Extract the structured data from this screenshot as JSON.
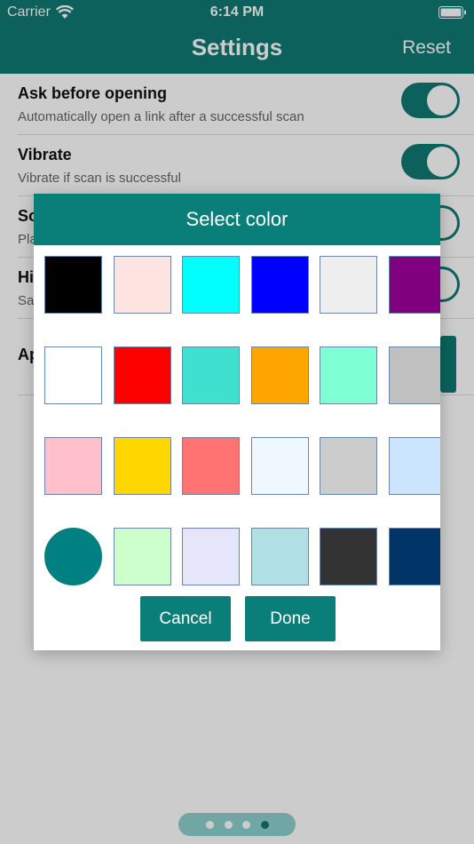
{
  "status_bar": {
    "carrier": "Carrier",
    "time": "6:14 PM"
  },
  "nav": {
    "title": "Settings",
    "reset": "Reset"
  },
  "settings": [
    {
      "title": "Ask before opening",
      "desc": "Automatically open a link after a successful scan",
      "toggle": true
    },
    {
      "title": "Vibrate",
      "desc": "Vibrate if scan is successful",
      "toggle": true
    },
    {
      "title": "So",
      "desc": "Pla",
      "toggle": true
    },
    {
      "title": "Hi",
      "desc": "Sa",
      "toggle": true
    },
    {
      "title": "Ap",
      "desc": ""
    }
  ],
  "dialog": {
    "title": "Select color",
    "cancel": "Cancel",
    "done": "Done",
    "colors": [
      "#000000",
      "#ffe4e1",
      "#00ffff",
      "#0000ff",
      "#eeeeee",
      "#800080",
      "#ffffff",
      "#ff0000",
      "#40e0d0",
      "#ffa500",
      "#7fffd4",
      "#c0c0c0",
      "#ffc0cb",
      "#ffd700",
      "#ff7373",
      "#f0f8ff",
      "#cccccc",
      "#cce5ff",
      "#008080",
      "#ccffcc",
      "#e6e6fa",
      "#b0e0e6",
      "#333333",
      "#003366"
    ],
    "selected_index": 18
  },
  "pager": {
    "count": 4,
    "active": 3
  },
  "theme": {
    "accent": "#0f7a74"
  }
}
